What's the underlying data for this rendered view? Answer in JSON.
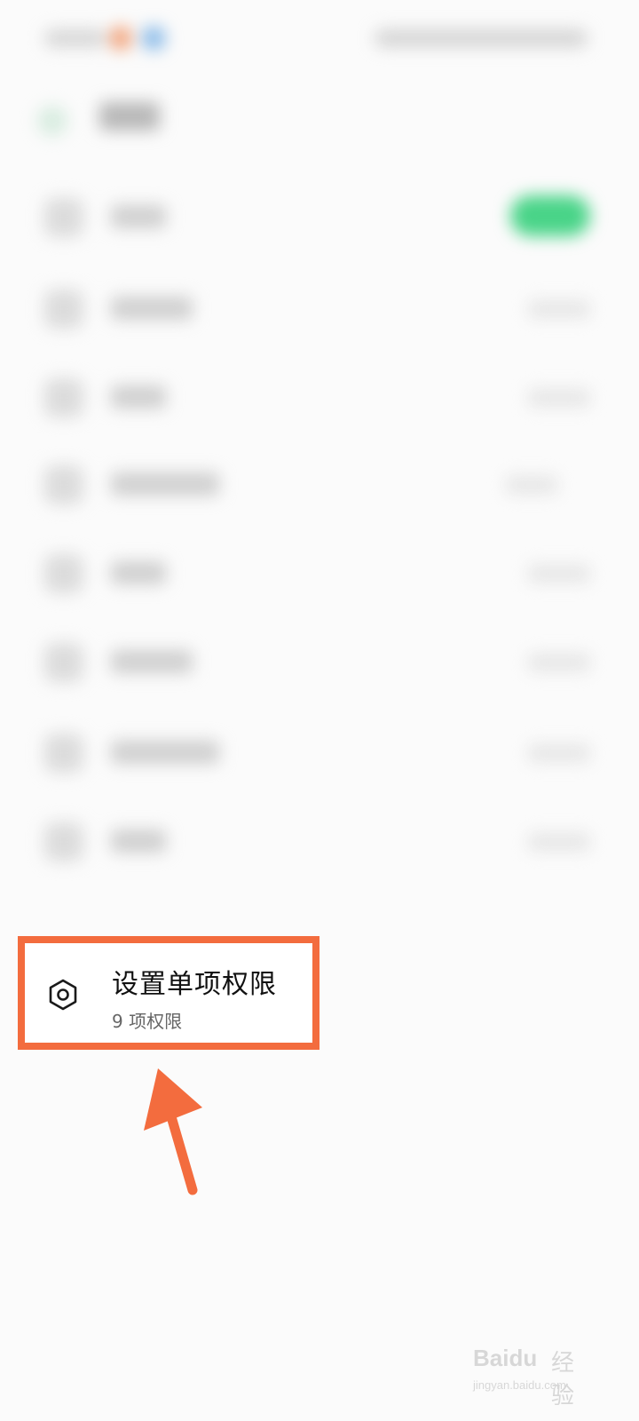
{
  "setting_item": {
    "title": "设置单项权限",
    "subtitle": "9 项权限",
    "icon": "settings-hexagon-icon"
  },
  "annotation": {
    "frame_color": "#f36c3e",
    "arrow_color": "#f36c3e"
  },
  "watermark": {
    "brand": "Baidu",
    "brand_suffix": "经验",
    "url": "jingyan.baidu.com"
  },
  "colors": {
    "toggle_on": "#49d488",
    "background": "#fbfbfb"
  }
}
